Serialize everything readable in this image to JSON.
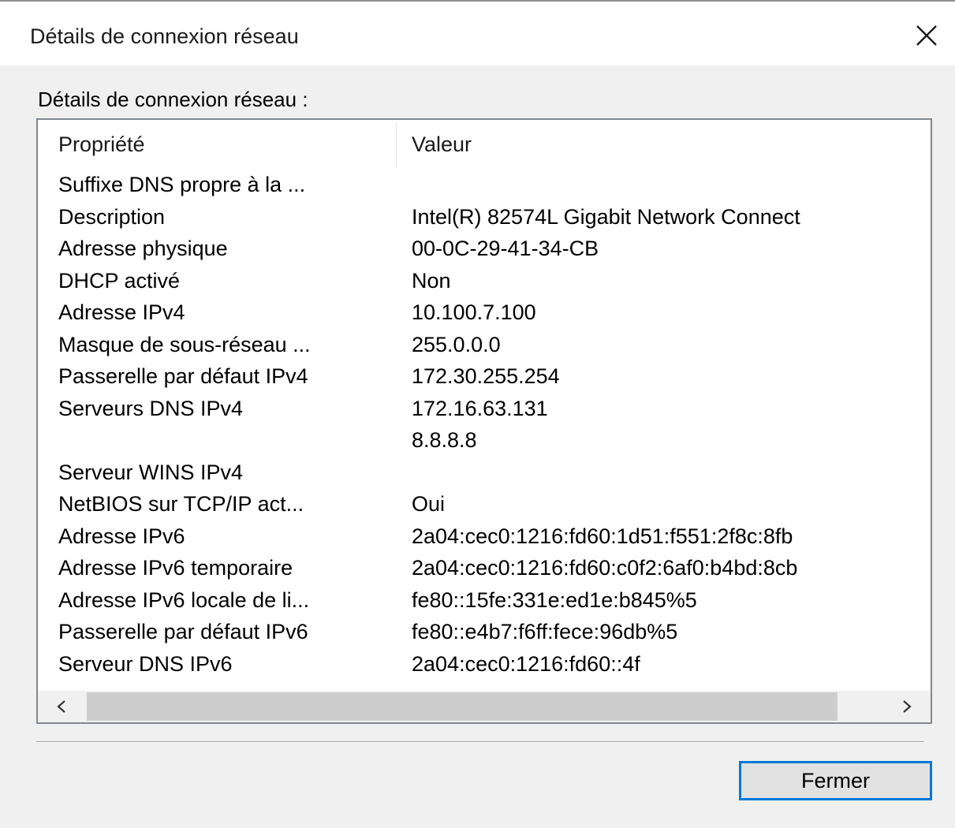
{
  "window": {
    "title": "Détails de connexion réseau"
  },
  "group_label": "Détails de connexion réseau :",
  "list": {
    "columns": [
      "Propriété",
      "Valeur"
    ],
    "rows": [
      {
        "property": "Suffixe DNS propre à la ...",
        "value": ""
      },
      {
        "property": "Description",
        "value": "Intel(R) 82574L Gigabit Network Connect"
      },
      {
        "property": "Adresse physique",
        "value": "00-0C-29-41-34-CB"
      },
      {
        "property": "DHCP activé",
        "value": "Non"
      },
      {
        "property": "Adresse IPv4",
        "value": "10.100.7.100"
      },
      {
        "property": "Masque de sous-réseau ...",
        "value": "255.0.0.0"
      },
      {
        "property": "Passerelle par défaut IPv4",
        "value": "172.30.255.254"
      },
      {
        "property": "Serveurs DNS IPv4",
        "value": "172.16.63.131"
      },
      {
        "property": "",
        "value": "8.8.8.8"
      },
      {
        "property": "Serveur WINS IPv4",
        "value": ""
      },
      {
        "property": "NetBIOS sur TCP/IP act...",
        "value": "Oui"
      },
      {
        "property": "Adresse IPv6",
        "value": "2a04:cec0:1216:fd60:1d51:f551:2f8c:8fb"
      },
      {
        "property": "Adresse IPv6 temporaire",
        "value": "2a04:cec0:1216:fd60:c0f2:6af0:b4bd:8cb"
      },
      {
        "property": "Adresse IPv6 locale de li...",
        "value": "fe80::15fe:331e:ed1e:b845%5"
      },
      {
        "property": "Passerelle par défaut IPv6",
        "value": "fe80::e4b7:f6ff:fece:96db%5"
      },
      {
        "property": "Serveur DNS IPv6",
        "value": "2a04:cec0:1216:fd60::4f"
      }
    ]
  },
  "scrollbar": {
    "left_arrow": "<",
    "right_arrow": ">"
  },
  "buttons": {
    "close_label": "Fermer"
  },
  "icons": {
    "close": "close-icon"
  },
  "colors": {
    "accent": "#0078d7",
    "dialog_background": "#f0f0f0",
    "list_background": "#ffffff",
    "scroll_thumb": "#cdcdcd"
  }
}
